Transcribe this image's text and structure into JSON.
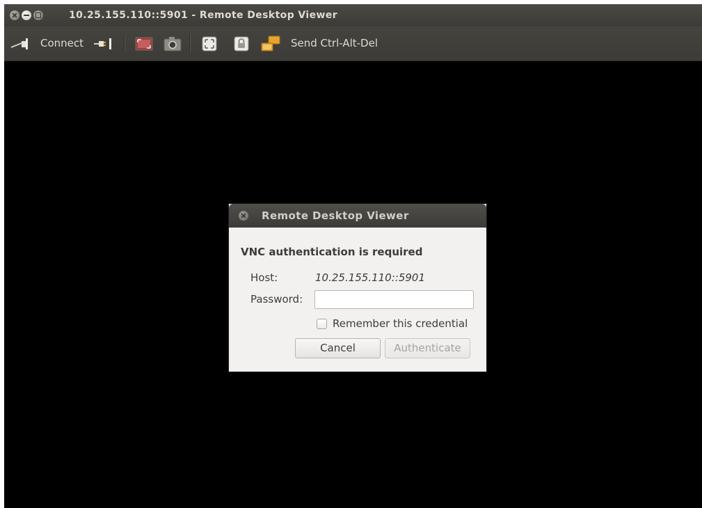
{
  "window": {
    "title": "10.25.155.110::5901 - Remote Desktop Viewer"
  },
  "toolbar": {
    "connect_label": "Connect",
    "send_keys_label": "Send Ctrl-Alt-Del",
    "icons": [
      "connect-icon",
      "disconnect-icon",
      "fullscreen-icon",
      "screenshot-icon",
      "scaling-icon",
      "keyboard-lock-icon",
      "send-keys-icon"
    ]
  },
  "dialog": {
    "title": "Remote Desktop Viewer",
    "heading": "VNC authentication is required",
    "host_label": "Host:",
    "host_value": "10.25.155.110::5901",
    "password_label": "Password:",
    "password_value": "",
    "remember_label": "Remember this credential",
    "remember_checked": false,
    "cancel_label": "Cancel",
    "authenticate_label": "Authenticate",
    "authenticate_enabled": false
  },
  "colors": {
    "titlebar": "#3c3b37",
    "toolbar_text": "#dfdbd2",
    "remote_screen": "#000000",
    "dialog_bg": "#f2f1f0"
  }
}
